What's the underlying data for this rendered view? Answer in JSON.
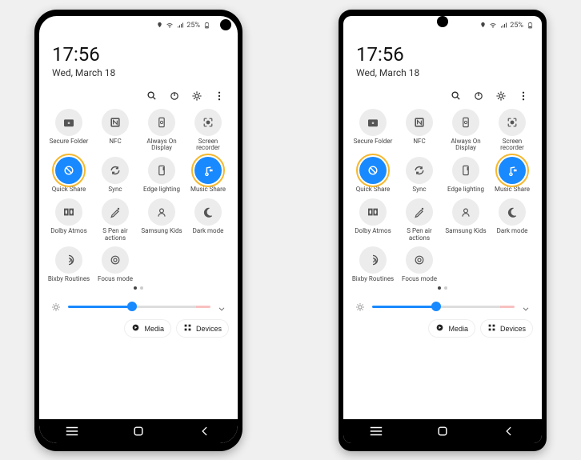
{
  "status": {
    "battery_pct": "25%",
    "location_icon": "location",
    "wifi_icon": "wifi",
    "signal_icon": "signal",
    "battery_icon": "battery"
  },
  "datetime": {
    "time": "17:56",
    "date": "Wed, March 18"
  },
  "toolbar": {
    "search": "search",
    "power": "power",
    "settings": "settings",
    "more": "more"
  },
  "tiles": [
    {
      "id": "secure-folder",
      "label": "Secure Folder",
      "icon": "folder-lock",
      "active": false,
      "highlight": false
    },
    {
      "id": "nfc",
      "label": "NFC",
      "icon": "nfc",
      "active": false,
      "highlight": false
    },
    {
      "id": "aod",
      "label": "Always On Display",
      "icon": "aod",
      "active": false,
      "highlight": false
    },
    {
      "id": "screen-recorder",
      "label": "Screen recorder",
      "icon": "screen-rec",
      "active": false,
      "highlight": false
    },
    {
      "id": "quick-share",
      "label": "Quick Share",
      "icon": "quick-share",
      "active": true,
      "highlight": true
    },
    {
      "id": "sync",
      "label": "Sync",
      "icon": "sync",
      "active": false,
      "highlight": false
    },
    {
      "id": "edge-lighting",
      "label": "Edge lighting",
      "icon": "edge",
      "active": false,
      "highlight": false
    },
    {
      "id": "music-share",
      "label": "Music Share",
      "icon": "music-share",
      "active": true,
      "highlight": true
    },
    {
      "id": "dolby",
      "label": "Dolby Atmos",
      "icon": "dolby",
      "active": false,
      "highlight": false
    },
    {
      "id": "spen",
      "label": "S Pen air actions",
      "icon": "spen",
      "active": false,
      "highlight": false
    },
    {
      "id": "kids",
      "label": "Samsung Kids",
      "icon": "kids",
      "active": false,
      "highlight": false
    },
    {
      "id": "dark",
      "label": "Dark mode",
      "icon": "dark",
      "active": false,
      "highlight": false
    },
    {
      "id": "bixby",
      "label": "Bixby Routines",
      "icon": "bixby",
      "active": false,
      "highlight": false
    },
    {
      "id": "focus",
      "label": "Focus mode",
      "icon": "focus",
      "active": false,
      "highlight": false
    }
  ],
  "chips": {
    "media": "Media",
    "devices": "Devices"
  },
  "navbar": {
    "recents": "recents",
    "home": "home",
    "back": "back"
  }
}
